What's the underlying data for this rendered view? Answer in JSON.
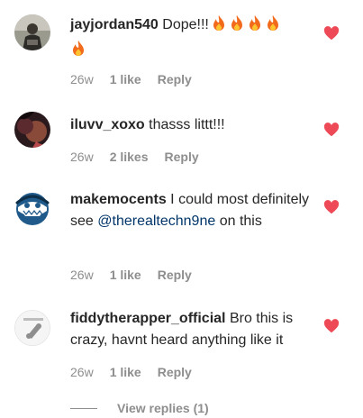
{
  "comments": [
    {
      "username": "jayjordan540",
      "text": "Dope!!!",
      "time": "26w",
      "likes": "1 like",
      "reply": "Reply",
      "emoji": [
        "fire-icon",
        "fire-icon",
        "fire-icon",
        "fire-icon",
        "fire-icon"
      ]
    },
    {
      "username": "iluvv_xoxo",
      "text": "thasss littt!!!",
      "time": "26w",
      "likes": "2 likes",
      "reply": "Reply"
    },
    {
      "username": "makemocents",
      "text_before": "I could most definitely see",
      "mention": "@therealtechn9ne",
      "text_after": "on this",
      "time": "26w",
      "likes": "1 like",
      "reply": "Reply"
    },
    {
      "username": "fiddytherapper_official",
      "text": "Bro this is crazy, havnt heard anything like it",
      "time": "26w",
      "likes": "1 like",
      "reply": "Reply"
    }
  ],
  "view_replies": "View replies (1)",
  "colors": {
    "heart": "#ed4956",
    "muted": "#8e8e8e",
    "mention": "#003569",
    "text": "#262626"
  }
}
